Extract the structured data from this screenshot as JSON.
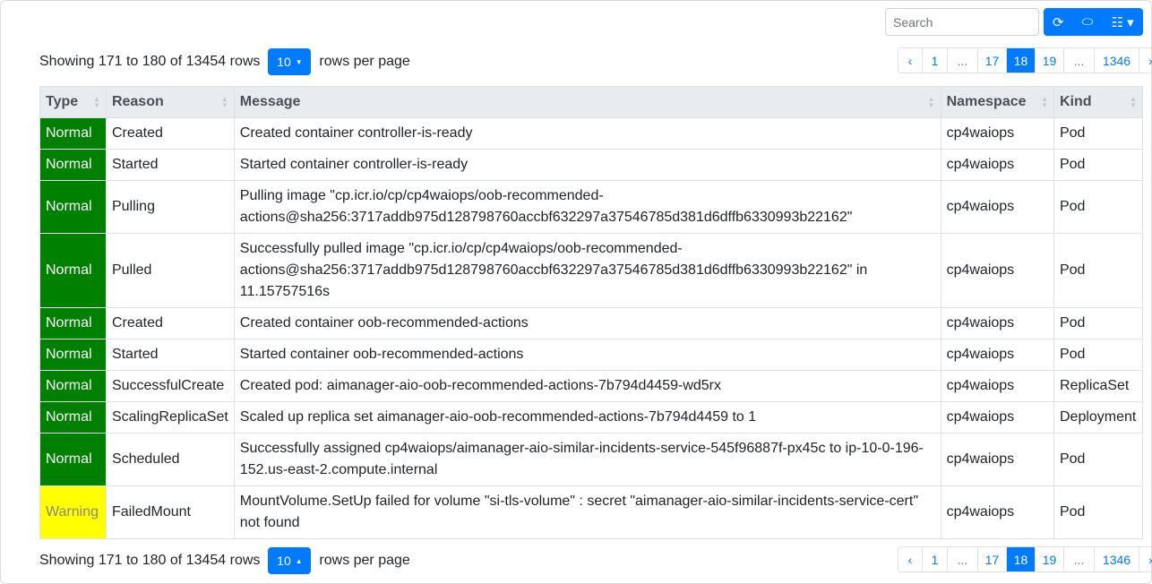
{
  "toolbar": {
    "search_placeholder": "Search",
    "refresh_icon": "⟳",
    "toggle_icon": "⬭",
    "columns_icon": "☷ ▾"
  },
  "pagination_info": {
    "text": "Showing 171 to 180 of 13454 rows",
    "page_size": "10",
    "suffix": "rows per page"
  },
  "pagination": [
    "‹",
    "1",
    "...",
    "17",
    "18",
    "19",
    "...",
    "1346",
    "›"
  ],
  "active_page": "18",
  "columns": [
    "Type",
    "Reason",
    "Message",
    "Namespace",
    "Kind"
  ],
  "colors": {
    "normal": "#008000",
    "warning": "#ffff00",
    "accent": "#007bff"
  },
  "rows": [
    {
      "type": "Normal",
      "reason": "Created",
      "message": "Created container controller-is-ready",
      "namespace": "cp4waiops",
      "kind": "Pod"
    },
    {
      "type": "Normal",
      "reason": "Started",
      "message": "Started container controller-is-ready",
      "namespace": "cp4waiops",
      "kind": "Pod"
    },
    {
      "type": "Normal",
      "reason": "Pulling",
      "message": "Pulling image \"cp.icr.io/cp/cp4waiops/oob-recommended-actions@sha256:3717addb975d128798760accbf632297a37546785d381d6dffb6330993b22162\"",
      "namespace": "cp4waiops",
      "kind": "Pod"
    },
    {
      "type": "Normal",
      "reason": "Pulled",
      "message": "Successfully pulled image \"cp.icr.io/cp/cp4waiops/oob-recommended-actions@sha256:3717addb975d128798760accbf632297a37546785d381d6dffb6330993b22162\" in 11.15757516s",
      "namespace": "cp4waiops",
      "kind": "Pod"
    },
    {
      "type": "Normal",
      "reason": "Created",
      "message": "Created container oob-recommended-actions",
      "namespace": "cp4waiops",
      "kind": "Pod"
    },
    {
      "type": "Normal",
      "reason": "Started",
      "message": "Started container oob-recommended-actions",
      "namespace": "cp4waiops",
      "kind": "Pod"
    },
    {
      "type": "Normal",
      "reason": "SuccessfulCreate",
      "message": "Created pod: aimanager-aio-oob-recommended-actions-7b794d4459-wd5rx",
      "namespace": "cp4waiops",
      "kind": "ReplicaSet"
    },
    {
      "type": "Normal",
      "reason": "ScalingReplicaSet",
      "message": "Scaled up replica set aimanager-aio-oob-recommended-actions-7b794d4459 to 1",
      "namespace": "cp4waiops",
      "kind": "Deployment"
    },
    {
      "type": "Normal",
      "reason": "Scheduled",
      "message": "Successfully assigned cp4waiops/aimanager-aio-similar-incidents-service-545f96887f-px45c to ip-10-0-196-152.us-east-2.compute.internal",
      "namespace": "cp4waiops",
      "kind": "Pod"
    },
    {
      "type": "Warning",
      "reason": "FailedMount",
      "message": "MountVolume.SetUp failed for volume \"si-tls-volume\" : secret \"aimanager-aio-similar-incidents-service-cert\" not found",
      "namespace": "cp4waiops",
      "kind": "Pod"
    }
  ]
}
